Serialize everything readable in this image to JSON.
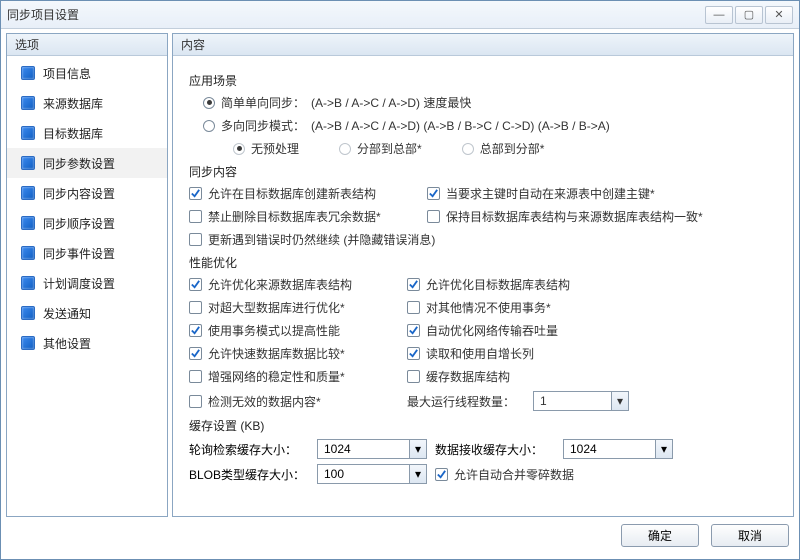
{
  "window": {
    "title": "同步项目设置"
  },
  "sidebar": {
    "header": "选项",
    "items": [
      {
        "label": "项目信息"
      },
      {
        "label": "来源数据库"
      },
      {
        "label": "目标数据库"
      },
      {
        "label": "同步参数设置"
      },
      {
        "label": "同步内容设置"
      },
      {
        "label": "同步顺序设置"
      },
      {
        "label": "同步事件设置"
      },
      {
        "label": "计划调度设置"
      },
      {
        "label": "发送通知"
      },
      {
        "label": "其他设置"
      }
    ],
    "selected_index": 3
  },
  "main": {
    "header": "内容",
    "sections": {
      "scenario": {
        "title": "应用场景",
        "options": [
          {
            "label": "简单单向同步：",
            "detail": "(A->B / A->C / A->D) 速度最快",
            "checked": true
          },
          {
            "label": "多向同步模式：",
            "detail": "(A->B / A->C / A->D) (A->B / B->C / C->D) (A->B / B->A)",
            "checked": false
          }
        ],
        "sub_options": [
          {
            "label": "无预处理"
          },
          {
            "label": "分部到总部*"
          },
          {
            "label": "总部到分部*"
          }
        ],
        "sub_checked_index": 0
      },
      "sync_content": {
        "title": "同步内容",
        "rows": [
          [
            {
              "label": "允许在目标数据库创建新表结构",
              "checked": true
            },
            {
              "label": "当要求主键时自动在来源表中创建主键*",
              "checked": true
            }
          ],
          [
            {
              "label": "禁止删除目标数据库表冗余数据*",
              "checked": false
            },
            {
              "label": "保持目标数据库表结构与来源数据库表结构一致*",
              "checked": false
            }
          ],
          [
            {
              "label": "更新遇到错误时仍然继续 (并隐藏错误消息)",
              "checked": false
            }
          ]
        ]
      },
      "performance": {
        "title": "性能优化",
        "rows": [
          [
            {
              "label": "允许优化来源数据库表结构",
              "checked": true
            },
            {
              "label": "允许优化目标数据库表结构",
              "checked": true
            }
          ],
          [
            {
              "label": "对超大型数据库进行优化*",
              "checked": false
            },
            {
              "label": "对其他情况不使用事务*",
              "checked": false
            }
          ],
          [
            {
              "label": "使用事务模式以提高性能",
              "checked": true
            },
            {
              "label": "自动优化网络传输吞吐量",
              "checked": true
            }
          ],
          [
            {
              "label": "允许快速数据库数据比较*",
              "checked": true
            },
            {
              "label": "读取和使用自增长列",
              "checked": true
            }
          ],
          [
            {
              "label": "增强网络的稳定性和质量*",
              "checked": false
            },
            {
              "label": "缓存数据库结构",
              "checked": false
            }
          ],
          [
            {
              "label": "检测无效的数据内容*",
              "checked": false
            },
            {
              "threads_label": "最大运行线程数量：",
              "threads_value": "1"
            }
          ]
        ]
      },
      "cache": {
        "title": "缓存设置 (KB)",
        "poll_label": "轮询检索缓存大小：",
        "poll_value": "1024",
        "recv_label": "数据接收缓存大小：",
        "recv_value": "1024",
        "blob_label": "BLOB类型缓存大小：",
        "blob_value": "100",
        "merge_label": "允许自动合并零碎数据",
        "merge_checked": true
      }
    }
  },
  "footer": {
    "ok": "确定",
    "cancel": "取消"
  }
}
